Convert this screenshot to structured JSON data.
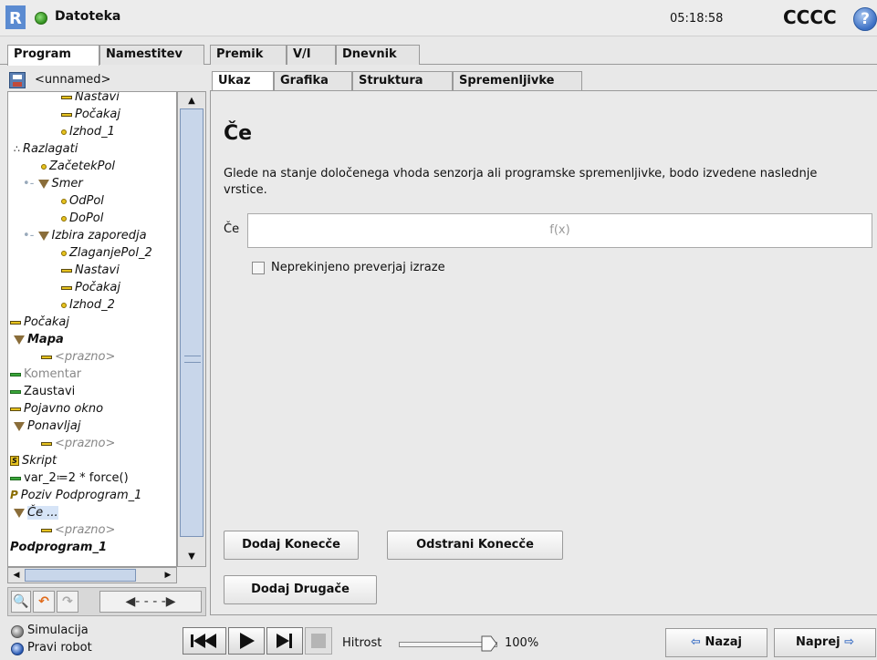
{
  "header": {
    "app_title": "Datoteka",
    "time": "05:18:58",
    "robot_name": "CCCC",
    "help_glyph": "?"
  },
  "main_tabs": [
    {
      "label": "Program",
      "active": true
    },
    {
      "label": "Namestitev",
      "active": false
    },
    {
      "label": "Premik",
      "active": false
    },
    {
      "label": "V/I",
      "active": false
    },
    {
      "label": "Dnevnik",
      "active": false
    }
  ],
  "left_panel": {
    "program_name": "<unnamed>",
    "tree": [
      {
        "label": "Nastavi",
        "icon": "set-icon",
        "style": "italic"
      },
      {
        "label": "Počakaj",
        "icon": "wait-icon",
        "style": "italic"
      },
      {
        "label": "Izhod_1",
        "icon": "waypoint-icon",
        "style": "italic"
      },
      {
        "label": "Razlagati",
        "icon": "palletizing-icon",
        "style": "italic"
      },
      {
        "label": "ZačetekPol",
        "icon": "waypoint-icon",
        "style": "italic"
      },
      {
        "label": "Smer",
        "icon": "folder-icon",
        "style": "italic"
      },
      {
        "label": "OdPol",
        "icon": "waypoint-icon",
        "style": "italic"
      },
      {
        "label": "DoPol",
        "icon": "waypoint-icon",
        "style": "italic"
      },
      {
        "label": "Izbira zaporedja",
        "icon": "folder-icon",
        "style": "italic"
      },
      {
        "label": "ZlaganjePol_2",
        "icon": "waypoint-icon",
        "style": "italic"
      },
      {
        "label": "Nastavi",
        "icon": "set-icon",
        "style": "italic"
      },
      {
        "label": "Počakaj",
        "icon": "wait-icon",
        "style": "italic"
      },
      {
        "label": "Izhod_2",
        "icon": "waypoint-icon",
        "style": "italic"
      },
      {
        "label": "Počakaj",
        "icon": "wait-icon",
        "style": "italic"
      },
      {
        "label": "Mapa",
        "icon": "folder-icon",
        "style": "bold"
      },
      {
        "label": "<prazno>",
        "icon": "empty-icon",
        "style": "gray"
      },
      {
        "label": "Komentar",
        "icon": "comment-icon",
        "style": "gray-normal"
      },
      {
        "label": "Zaustavi",
        "icon": "halt-icon",
        "style": "normal"
      },
      {
        "label": "Pojavno okno",
        "icon": "popup-icon",
        "style": "italic"
      },
      {
        "label": "Ponavljaj",
        "icon": "loop-icon",
        "style": "italic"
      },
      {
        "label": "<prazno>",
        "icon": "empty-icon",
        "style": "gray"
      },
      {
        "label": "Skript",
        "icon": "script-icon",
        "style": "italic"
      },
      {
        "label": "var_2≔2 * force()",
        "icon": "assignment-icon",
        "style": "normal"
      },
      {
        "label": "Poziv Podprogram_1",
        "icon": "call-icon",
        "style": "italic"
      },
      {
        "label": "Če ...",
        "icon": "if-icon",
        "style": "italic-selected"
      },
      {
        "label": "<prazno>",
        "icon": "empty-icon",
        "style": "gray"
      },
      {
        "label": "Podprogram_1",
        "icon": "",
        "style": "bold"
      }
    ],
    "tools": [
      "search-icon",
      "undo-icon",
      "redo-icon",
      "move-arrows-icon"
    ]
  },
  "sub_tabs": [
    {
      "label": "Ukaz",
      "active": true
    },
    {
      "label": "Grafika",
      "active": false
    },
    {
      "label": "Struktura",
      "active": false
    },
    {
      "label": "Spremenljivke",
      "active": false
    }
  ],
  "command": {
    "title": "Če",
    "description": "Glede na stanje določenega vhoda senzorja ali programske spremenljivke, bodo izvedene naslednje vrstice.",
    "expr_label": "Če",
    "expr_placeholder": "f(x)",
    "checkbox_label": "Neprekinjeno preverjaj izraze",
    "checkbox_checked": false,
    "btn_add_elseif": "Dodaj Konecče",
    "btn_remove_elseif": "Odstrani Konecče",
    "btn_add_else": "Dodaj Drugače"
  },
  "footer": {
    "simulation_label": "Simulacija",
    "real_robot_label": "Pravi robot",
    "speed_label": "Hitrost",
    "speed_value": "100%",
    "speed_fraction": 1.0,
    "back_label": "Nazaj",
    "next_label": "Naprej"
  },
  "colors": {
    "accent": "#3b6fc4",
    "status_green": "#2f8d1c",
    "background": "#e8e8e8"
  }
}
